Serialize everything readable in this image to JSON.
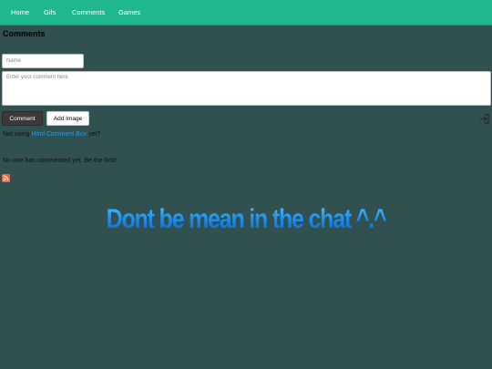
{
  "nav": {
    "items": [
      {
        "label": "Home"
      },
      {
        "label": "Gifs"
      },
      {
        "label": "Comments"
      },
      {
        "label": "Games"
      }
    ]
  },
  "page": {
    "title": "Comments"
  },
  "form": {
    "name_placeholder": "Name",
    "comment_placeholder": "Enter your comment here",
    "comment_button": "Comment",
    "add_image_button": "Add Image"
  },
  "promo": {
    "prefix": "Not using ",
    "link": "Html Comment Box",
    "suffix": " yet?"
  },
  "empty_message": "No one has commented yet. Be the first!",
  "banner": {
    "text": "Dont be mean in the chat ^.^"
  },
  "icons": {
    "login": "login-icon",
    "rss": "rss-icon"
  },
  "colors": {
    "page_background": "#315050",
    "navbar": "#1fb88d",
    "link": "#2f9bd9",
    "banner": "#1a8fe8",
    "rss": "#e8663a"
  }
}
